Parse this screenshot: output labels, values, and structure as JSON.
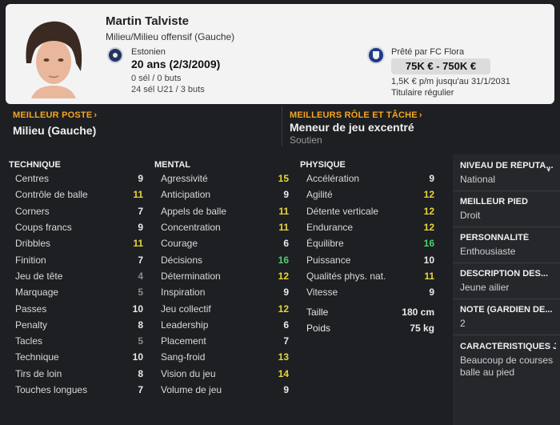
{
  "player": {
    "name": "Martin Talviste",
    "role": "Milieu/Milieu offensif (Gauche)",
    "nationality": "Estonien",
    "age": "20 ans (2/3/2009)",
    "caps_senior": "0 sél / 0 buts",
    "caps_u21": "24 sél U21 / 3 buts",
    "loan": "Prêté par FC Flora",
    "value": "75K € - 750K €",
    "wage": "1,5K € p/m jusqu'au 31/1/2031",
    "status": "Titulaire régulier"
  },
  "best_position": {
    "title": "MEILLEUR POSTE",
    "value": "Milieu (Gauche)"
  },
  "best_role": {
    "title": "MEILLEURS RÔLE ET TÂCHE",
    "value": "Meneur de jeu excentré",
    "sub": "Soutien"
  },
  "technique": {
    "title": "TECHNIQUE",
    "rows": [
      {
        "label": "Centres",
        "value": "9",
        "color": "#eaeaea"
      },
      {
        "label": "Contrôle de balle",
        "value": "11",
        "color": "#e8d63a"
      },
      {
        "label": "Corners",
        "value": "7",
        "color": "#eaeaea"
      },
      {
        "label": "Coups francs",
        "value": "9",
        "color": "#eaeaea"
      },
      {
        "label": "Dribbles",
        "value": "11",
        "color": "#e8d63a"
      },
      {
        "label": "Finition",
        "value": "7",
        "color": "#eaeaea"
      },
      {
        "label": "Jeu de tête",
        "value": "4",
        "color": "#8a8a8a"
      },
      {
        "label": "Marquage",
        "value": "5",
        "color": "#8a8a8a"
      },
      {
        "label": "Passes",
        "value": "10",
        "color": "#eaeaea"
      },
      {
        "label": "Penalty",
        "value": "8",
        "color": "#eaeaea"
      },
      {
        "label": "Tacles",
        "value": "5",
        "color": "#8a8a8a"
      },
      {
        "label": "Technique",
        "value": "10",
        "color": "#eaeaea"
      },
      {
        "label": "Tirs de loin",
        "value": "8",
        "color": "#eaeaea"
      },
      {
        "label": "Touches longues",
        "value": "7",
        "color": "#eaeaea"
      }
    ]
  },
  "mental": {
    "title": "MENTAL",
    "rows": [
      {
        "label": "Agressivité",
        "value": "15",
        "color": "#e8d63a"
      },
      {
        "label": "Anticipation",
        "value": "9",
        "color": "#eaeaea"
      },
      {
        "label": "Appels de balle",
        "value": "11",
        "color": "#e8d63a"
      },
      {
        "label": "Concentration",
        "value": "11",
        "color": "#e8d63a"
      },
      {
        "label": "Courage",
        "value": "6",
        "color": "#eaeaea"
      },
      {
        "label": "Décisions",
        "value": "16",
        "color": "#4ed36a"
      },
      {
        "label": "Détermination",
        "value": "12",
        "color": "#e8d63a"
      },
      {
        "label": "Inspiration",
        "value": "9",
        "color": "#eaeaea"
      },
      {
        "label": "Jeu collectif",
        "value": "12",
        "color": "#e8d63a"
      },
      {
        "label": "Leadership",
        "value": "6",
        "color": "#eaeaea"
      },
      {
        "label": "Placement",
        "value": "7",
        "color": "#eaeaea"
      },
      {
        "label": "Sang-froid",
        "value": "13",
        "color": "#e8d63a"
      },
      {
        "label": "Vision du jeu",
        "value": "14",
        "color": "#e8d63a"
      },
      {
        "label": "Volume de jeu",
        "value": "9",
        "color": "#eaeaea"
      }
    ]
  },
  "physique": {
    "title": "PHYSIQUE",
    "rows": [
      {
        "label": "Accélération",
        "value": "9",
        "color": "#eaeaea"
      },
      {
        "label": "Agilité",
        "value": "12",
        "color": "#e8d63a"
      },
      {
        "label": "Détente verticale",
        "value": "12",
        "color": "#e8d63a"
      },
      {
        "label": "Endurance",
        "value": "12",
        "color": "#e8d63a"
      },
      {
        "label": "Équilibre",
        "value": "16",
        "color": "#4ed36a"
      },
      {
        "label": "Puissance",
        "value": "10",
        "color": "#eaeaea"
      },
      {
        "label": "Qualités phys. nat.",
        "value": "11",
        "color": "#e8d63a"
      },
      {
        "label": "Vitesse",
        "value": "9",
        "color": "#eaeaea"
      }
    ],
    "height_label": "Taille",
    "height_value": "180 cm",
    "weight_label": "Poids",
    "weight_value": "75 kg"
  },
  "side": {
    "reputation_title": "NIVEAU DE RÉPUTA...",
    "reputation_value": "National",
    "foot_title": "MEILLEUR PIED",
    "foot_value": "Droit",
    "personality_title": "PERSONNALITÉ",
    "personality_value": "Enthousiaste",
    "description_title": "DESCRIPTION DES...",
    "description_value": "Jeune ailier",
    "gk_title": "NOTE (GARDIEN DE...",
    "gk_value": "2",
    "traits_title": "CARACTÉRISTIQUES J",
    "traits_value": "Beaucoup de courses balle au pied"
  },
  "icons": {
    "nation_flag": "estonia-flag-icon",
    "club_badge": "fc-flora-badge-icon",
    "chevron": "chevron-right-icon"
  }
}
